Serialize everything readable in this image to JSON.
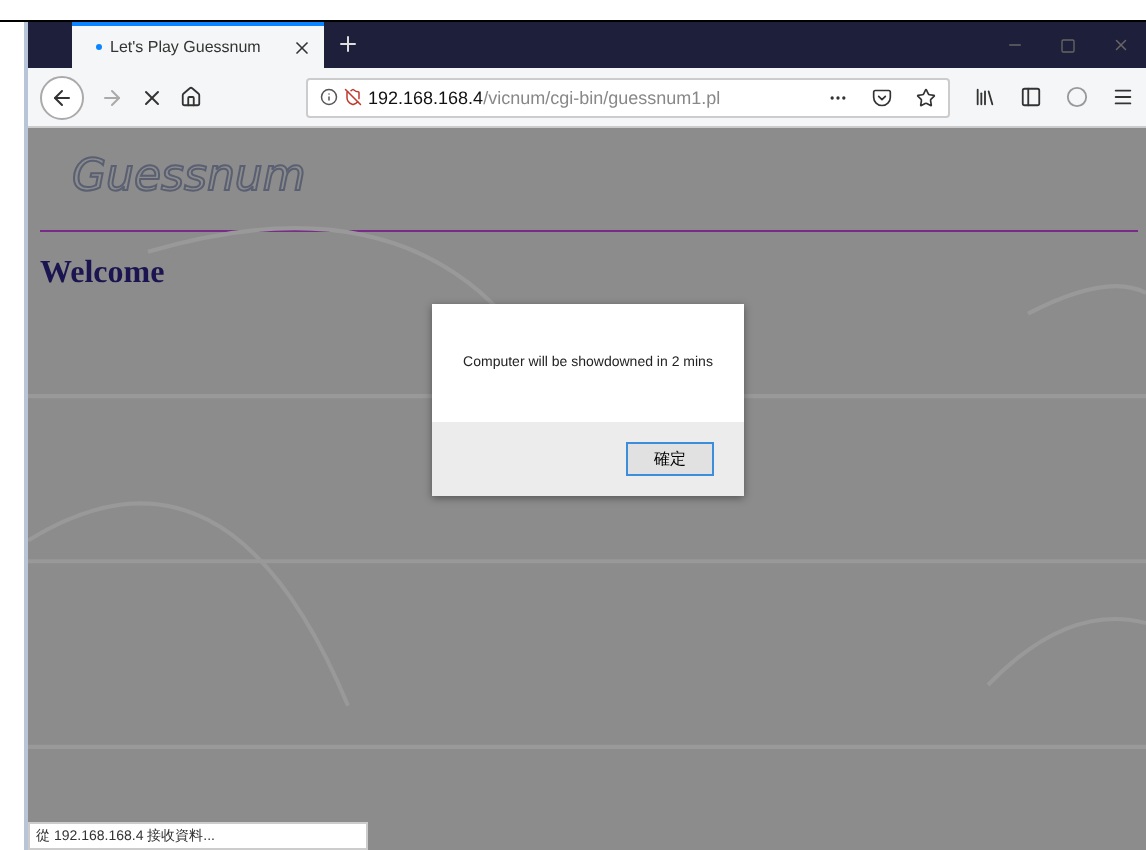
{
  "tab": {
    "title": "Let's Play Guessnum",
    "selected": true
  },
  "address": {
    "host": "192.168.168.4",
    "path": "/vicnum/cgi-bin/guessnum1.pl"
  },
  "page": {
    "logo": "Guessnum",
    "heading": "Welcome"
  },
  "dialog": {
    "message": "Computer will be showdowned in 2 mins",
    "button": "確定"
  },
  "status_bar": "從 192.168.168.4 接收資料..."
}
